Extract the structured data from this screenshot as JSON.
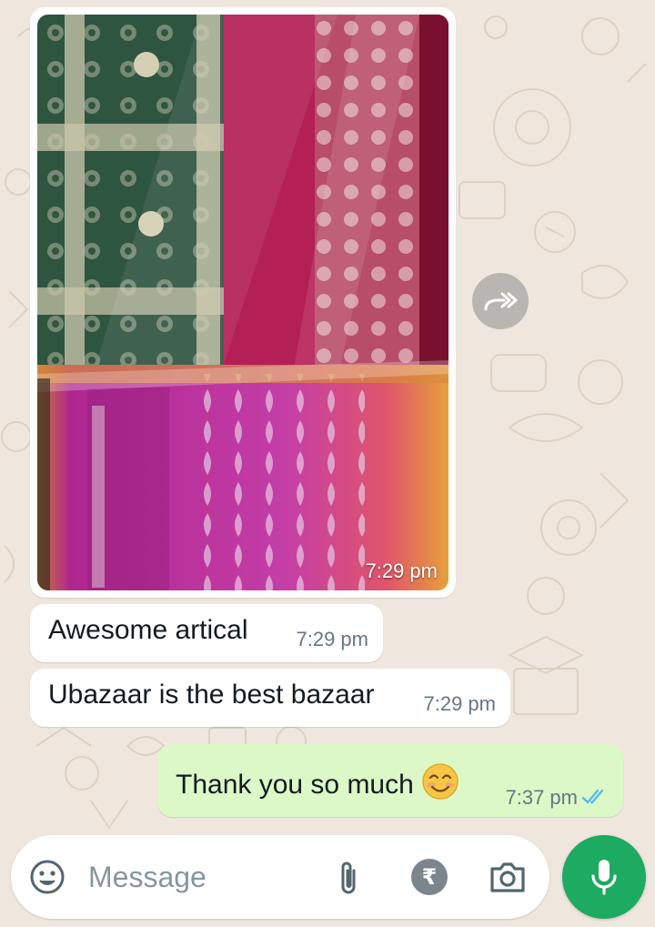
{
  "chat": {
    "messages": [
      {
        "type": "image",
        "direction": "in",
        "time": "7:29 pm",
        "image_desc": "saree-photo"
      },
      {
        "type": "text",
        "direction": "in",
        "text": "Awesome artical",
        "time": "7:29 pm"
      },
      {
        "type": "text",
        "direction": "in",
        "text": "Ubazaar is the best bazaar",
        "time": "7:29 pm"
      },
      {
        "type": "text",
        "direction": "out",
        "text": "Thank you so much",
        "emoji": "smiling-face-icon",
        "time": "7:37 pm",
        "status": "read"
      }
    ]
  },
  "composer": {
    "placeholder": "Message",
    "icons": [
      "emoji-icon",
      "attach-icon",
      "rupee-icon",
      "camera-icon",
      "mic-icon"
    ]
  },
  "colors": {
    "background": "#efe7dd",
    "incoming_bubble": "#ffffff",
    "outgoing_bubble": "#dcf8c6",
    "read_ticks": "#53bdeb",
    "mic_button": "#1daa61"
  }
}
